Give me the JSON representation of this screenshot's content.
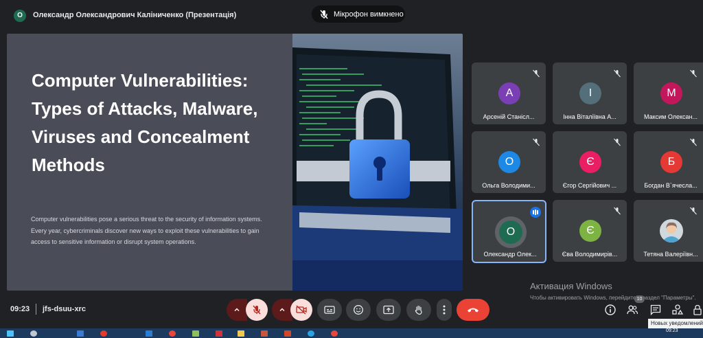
{
  "header": {
    "presenter_initial": "О",
    "presenter_title": "Олександр Олександрович Каліниченко (Презентація)",
    "mic_status": "Мікрофон вимкнено"
  },
  "slide": {
    "title": "Computer Vulnerabilities: Types of Attacks, Malware, Viruses and Concealment Methods",
    "body": "Computer vulnerabilities pose a serious threat to the security of information systems. Every year, cybercriminals discover new ways to exploit these vulnerabilities to gain access to sensitive information or disrupt system operations."
  },
  "participants": [
    {
      "initial": "А",
      "name": "Арсеній Станісл...",
      "color": "#7b3fb5",
      "muted": true
    },
    {
      "initial": "І",
      "name": "Інна Віталіївна А...",
      "color": "#546e7a",
      "muted": true
    },
    {
      "initial": "М",
      "name": "Максим Олексан...",
      "color": "#c2185b",
      "muted": true
    },
    {
      "initial": "О",
      "name": "Ольга Володими...",
      "color": "#1e88e5",
      "muted": true
    },
    {
      "initial": "Є",
      "name": "Єгор Сергійович ...",
      "color": "#e91e63",
      "muted": true
    },
    {
      "initial": "Б",
      "name": "Богдан В`ячесла...",
      "color": "#e53935",
      "muted": true
    },
    {
      "initial": "О",
      "name": "Олександр Олек...",
      "color": "#1e6b52",
      "muted": false,
      "speaking": true
    },
    {
      "initial": "Є",
      "name": "Єва Володимирів...",
      "color": "#7cb342",
      "muted": true
    },
    {
      "initial": "",
      "name": "Тетяна Валеріївн...",
      "color": "#d7ccc8",
      "muted": true,
      "photo": true
    }
  ],
  "watermark": {
    "title": "Активация Windows",
    "subtitle": "Чтобы активировать Windows, перейдите в раздел \"Параметры\"."
  },
  "footer": {
    "time": "09:23",
    "meeting_code": "jfs-dsuu-xrc",
    "participants_badge": "10",
    "notification_tooltip": "Новых уведомлений"
  },
  "taskbar": {
    "clock": "09:23"
  },
  "colors": {
    "end_call": "#ea4335",
    "muted_control_bg": "#f9dedc",
    "muted_control_dark": "#5c1a1b",
    "active_border": "#8ab4f8"
  }
}
